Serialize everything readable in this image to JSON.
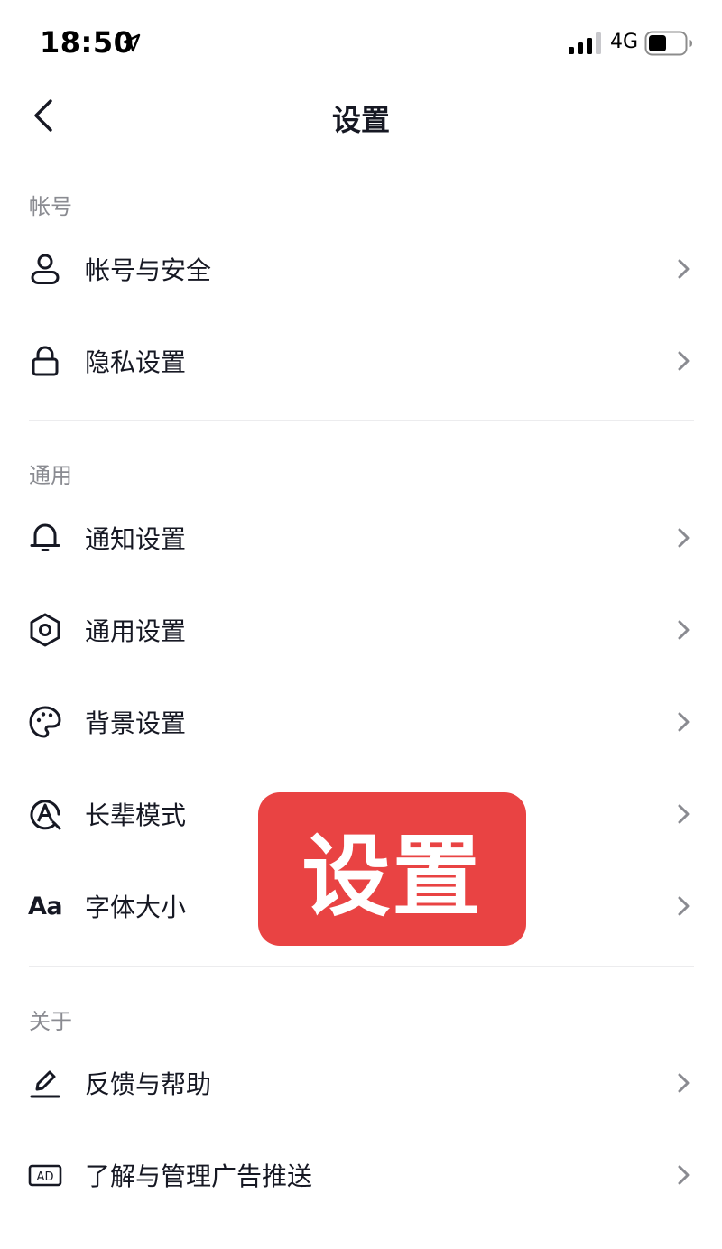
{
  "status_bar": {
    "time": "18:50",
    "network": "4G",
    "battery_level": 0.5,
    "signal_bars": 3
  },
  "nav": {
    "title": "设置"
  },
  "sections": [
    {
      "header": "帐号",
      "items": [
        {
          "label": "帐号与安全",
          "icon": "user-icon"
        },
        {
          "label": "隐私设置",
          "icon": "lock-icon"
        }
      ]
    },
    {
      "header": "通用",
      "items": [
        {
          "label": "通知设置",
          "icon": "bell-icon"
        },
        {
          "label": "通用设置",
          "icon": "gear-icon"
        },
        {
          "label": "背景设置",
          "icon": "palette-icon"
        },
        {
          "label": "长辈模式",
          "icon": "elder-mode-icon"
        },
        {
          "label": "字体大小",
          "icon": "font-size-icon",
          "icon_text": "Aa"
        }
      ]
    },
    {
      "header": "关于",
      "items": [
        {
          "label": "反馈与帮助",
          "icon": "edit-pen-icon"
        },
        {
          "label": "了解与管理广告推送",
          "icon": "ad-icon",
          "icon_text": "AD"
        }
      ]
    }
  ],
  "overlay": {
    "text": "设置",
    "color": "#e94343"
  },
  "colors": {
    "text": "#161823",
    "secondary": "#8a8b91",
    "chevron": "#8a8b91",
    "divider": "#ececee"
  }
}
